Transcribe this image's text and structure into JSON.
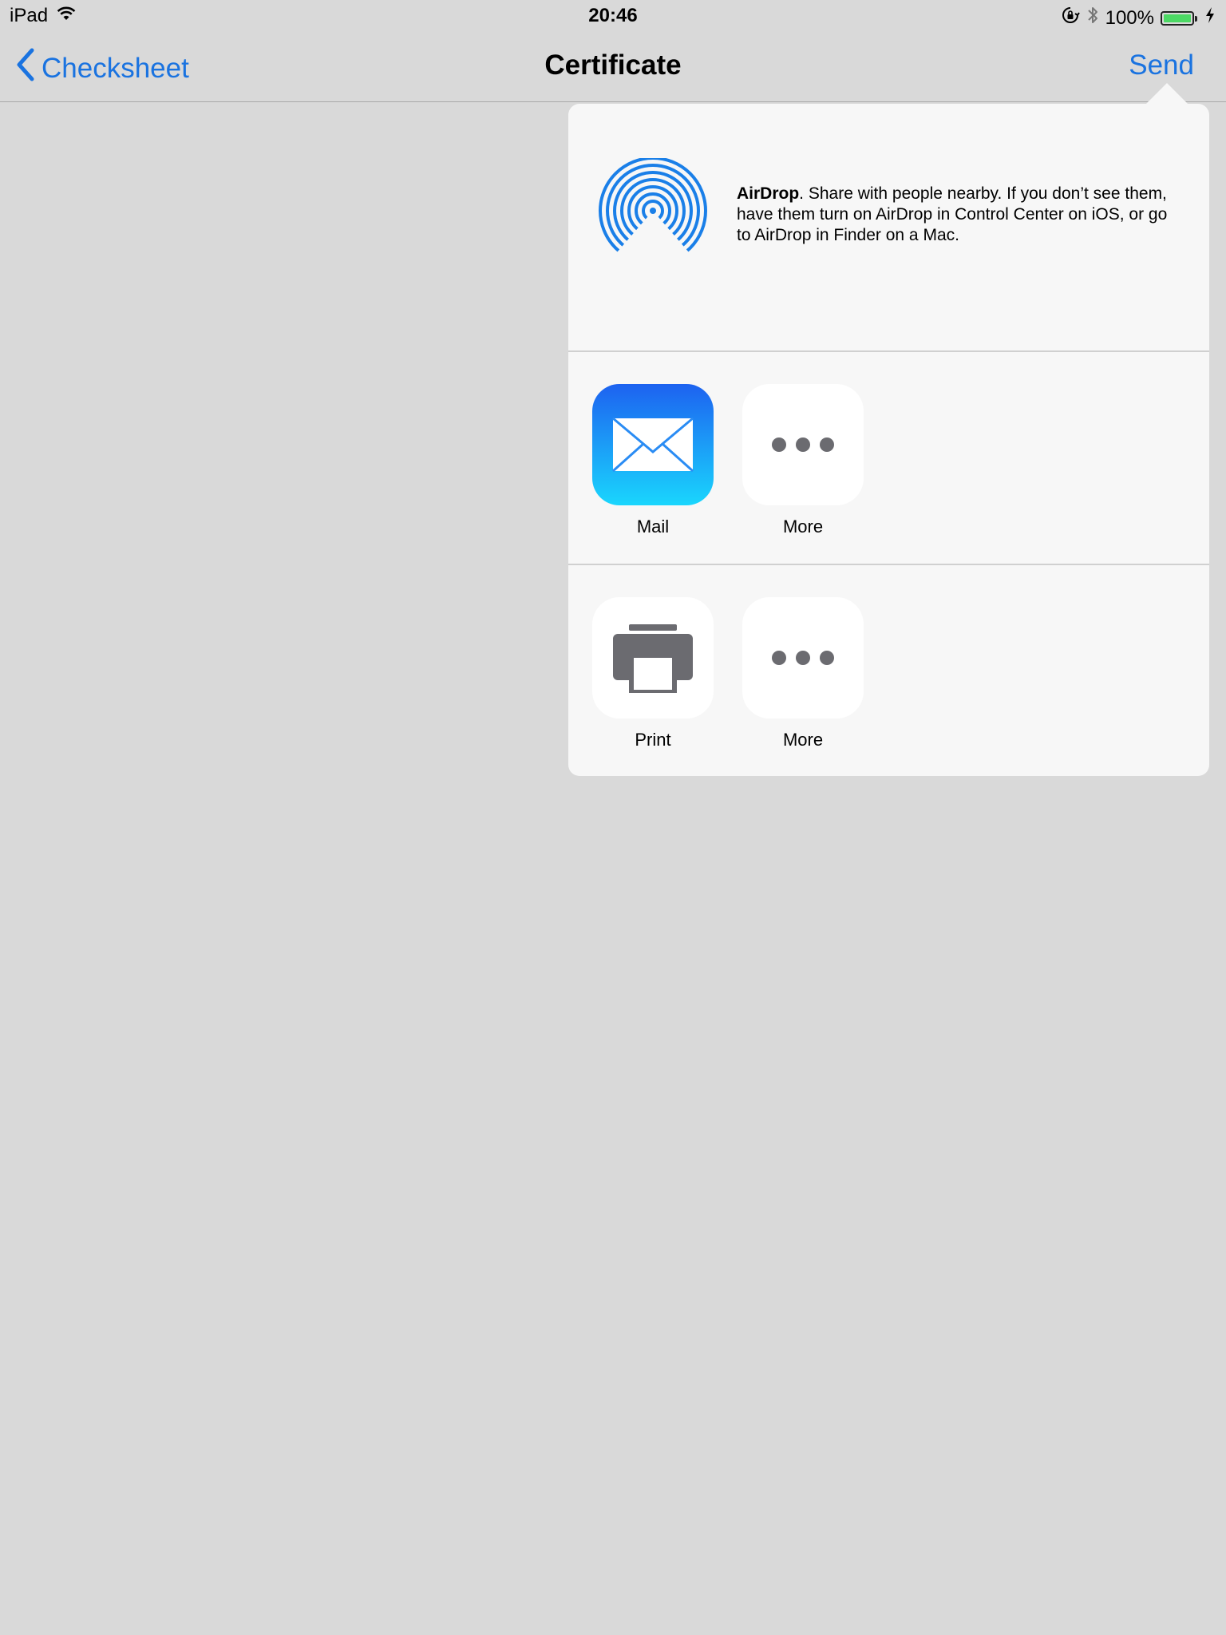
{
  "status_bar": {
    "device": "iPad",
    "time": "20:46",
    "battery_percent": "100%"
  },
  "nav": {
    "back_label": "Checksheet",
    "title": "Certificate",
    "action_label": "Send"
  },
  "airdrop": {
    "title": "AirDrop",
    "description": ". Share with people nearby. If you don’t see them, have them turn on AirDrop in Control Center on iOS, or go to AirDrop in Finder on a Mac."
  },
  "share_row": {
    "items": [
      {
        "label": "Mail",
        "icon": "mail-icon"
      },
      {
        "label": "More",
        "icon": "more-icon"
      }
    ]
  },
  "action_row": {
    "items": [
      {
        "label": "Print",
        "icon": "printer-icon"
      },
      {
        "label": "More",
        "icon": "more-icon"
      }
    ]
  },
  "colors": {
    "accent": "#1a73e0",
    "background": "#d9d9d9",
    "popover": "#f7f7f7",
    "battery": "#4cd964"
  }
}
